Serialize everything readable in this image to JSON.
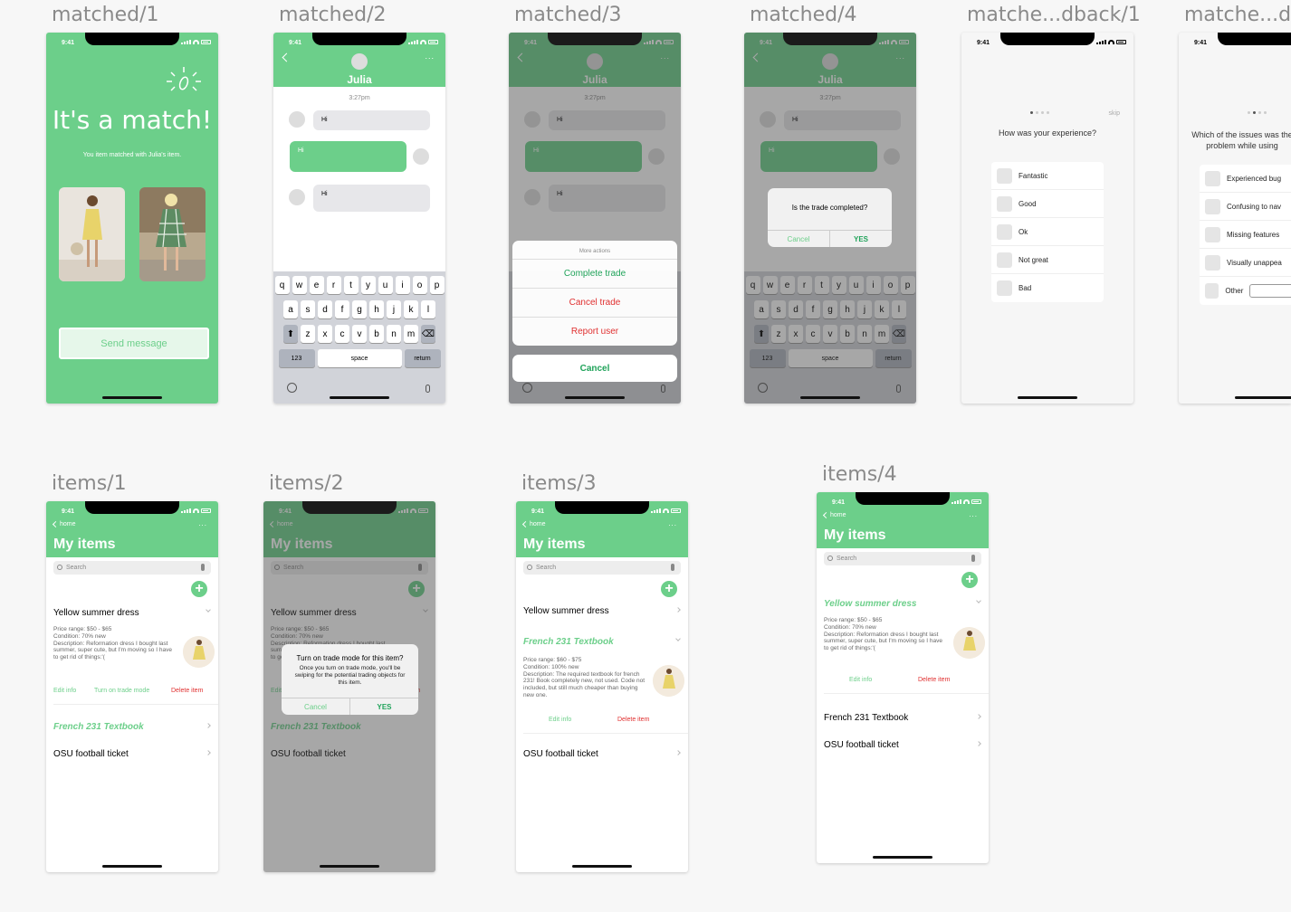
{
  "frames": {
    "matched_1": "matched/1",
    "matched_2": "matched/2",
    "matched_3": "matched/3",
    "matched_4": "matched/4",
    "feedback_1": "matche...dback/1",
    "feedback_2": "matche...db",
    "items_1": "items/1",
    "items_2": "items/2",
    "items_3": "items/3",
    "items_4": "items/4"
  },
  "status": {
    "time": "9:41"
  },
  "match": {
    "title": "It's a match!",
    "subtitle": "You item matched with Julia's item.",
    "send_button": "Send message"
  },
  "chat": {
    "name": "Julia",
    "time": "3:27pm",
    "more": "...",
    "messages": [
      "Hi",
      "Hi",
      "Hi"
    ]
  },
  "keyboard": {
    "row1": [
      "q",
      "w",
      "e",
      "r",
      "t",
      "y",
      "u",
      "i",
      "o",
      "p"
    ],
    "row2": [
      "a",
      "s",
      "d",
      "f",
      "g",
      "h",
      "j",
      "k",
      "l"
    ],
    "row3": [
      "z",
      "x",
      "c",
      "v",
      "b",
      "n",
      "m"
    ],
    "shift": "⬆",
    "delete": "⌫",
    "numbers": "123",
    "space": "space",
    "return": "return"
  },
  "action_sheet": {
    "header": "More actions",
    "complete": "Complete trade",
    "cancel_trade": "Cancel trade",
    "report": "Report user",
    "cancel": "Cancel"
  },
  "trade_alert": {
    "title": "Is the trade completed?",
    "cancel": "Cancel",
    "yes": "YES"
  },
  "feedback1": {
    "skip": "skip",
    "question": "How was your experience?",
    "options": [
      "Fantastic",
      "Good",
      "Ok",
      "Not great",
      "Bad"
    ]
  },
  "feedback2": {
    "question": "Which of the issues was the problem while using",
    "options": [
      "Experienced bug",
      "Confusing to nav",
      "Missing features",
      "Visually unappea",
      "Other"
    ]
  },
  "items": {
    "back": "home",
    "more": "...",
    "title": "My items",
    "search_placeholder": "Search",
    "add": "+",
    "dress": "Yellow summer dress",
    "dress_desc": "Price range: $50 - $65\nCondition: 70% new\nDescription: Reformation dress I bought last summer, super cute, but I'm moving so I have to get rid of things:'(",
    "textbook": "French 231 Textbook",
    "textbook_desc": "Price range: $60 - $75\nCondition: 100% new\nDescription: The required textbook for french 231! Book completely new, not used. Code not included, but still much cheaper than buying new one.",
    "ticket": "OSU football ticket",
    "edit": "Edit info",
    "trade_mode": "Turn on trade mode",
    "delete": "Delete item"
  },
  "trade_mode_alert": {
    "title": "Turn on trade mode for this item?",
    "body": "Once you turn on trade mode, you'll be swiping for the potential trading objects for this item.",
    "cancel": "Cancel",
    "yes": "YES"
  },
  "colors": {
    "accent": "#6ccf8a",
    "danger": "#e03030",
    "dim": "rgba(60,60,60,0.45)"
  }
}
